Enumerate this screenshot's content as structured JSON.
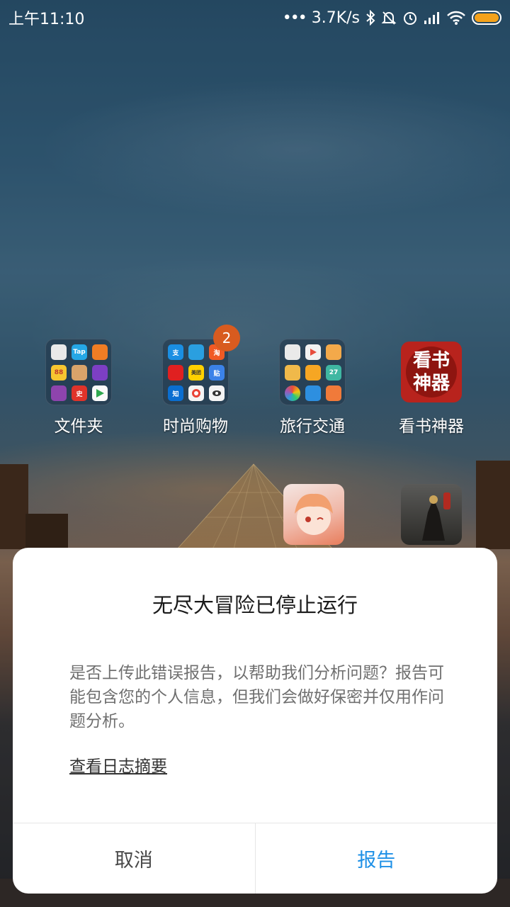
{
  "status_bar": {
    "time": "上午11:10",
    "network_speed": "3.7K/s",
    "icons": [
      "bluetooth-icon",
      "mute-icon",
      "alarm-icon",
      "signal-icon",
      "wifi-icon",
      "battery-icon"
    ],
    "battery_color": "#f5a21b"
  },
  "home": {
    "apps": [
      {
        "label": "文件夹",
        "type": "folder"
      },
      {
        "label": "时尚购物",
        "type": "folder",
        "badge": "2"
      },
      {
        "label": "旅行交通",
        "type": "folder"
      },
      {
        "label": "看书神器",
        "type": "app",
        "tile_text_1": "看书",
        "tile_text_2": "神器"
      }
    ],
    "folder_1_minis": [
      "",
      "Tap",
      "",
      "88",
      "",
      "",
      "",
      "史",
      ""
    ],
    "folder_2_minis": [
      "支",
      "",
      "淘",
      "",
      "美团",
      "贴",
      "知",
      "",
      ""
    ],
    "folder_3_minis": [
      "",
      "",
      "",
      "",
      "",
      "27",
      "",
      "",
      ""
    ]
  },
  "dialog": {
    "title": "无尽大冒险已停止运行",
    "message": "是否上传此错误报告，以帮助我们分析问题？报告可能包含您的个人信息，但我们会做好保密并仅用作问题分析。",
    "link": "查看日志摘要",
    "cancel_label": "取消",
    "report_label": "报告",
    "accent_color": "#1e90e6"
  }
}
